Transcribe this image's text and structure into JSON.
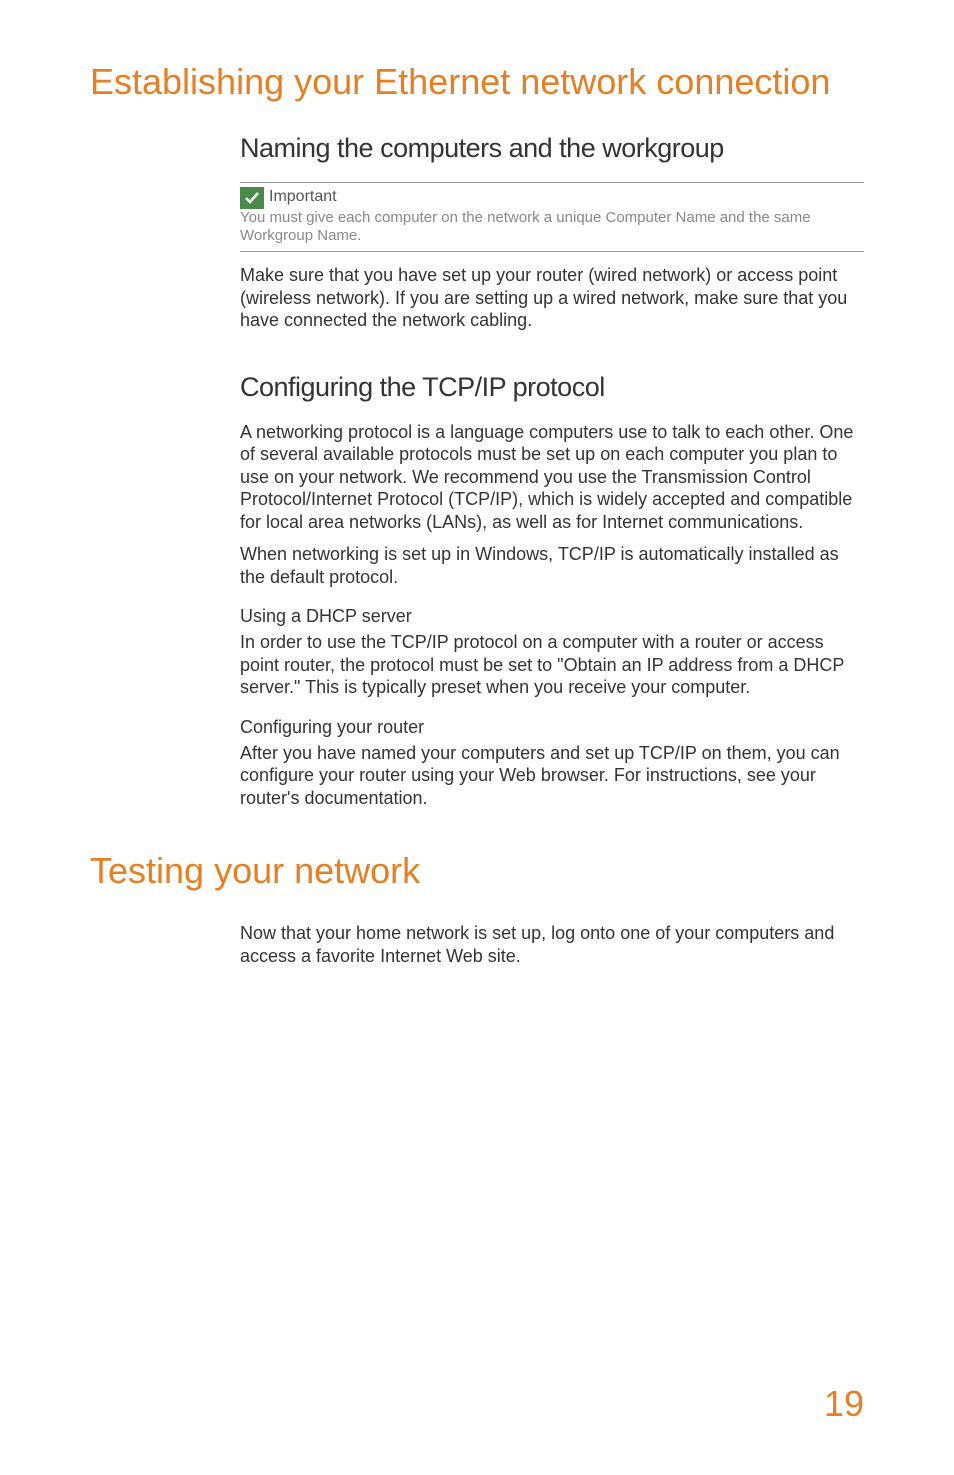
{
  "section1": {
    "title": "Establishing your Ethernet network connection",
    "sub1": {
      "title": "Naming the computers and the workgroup",
      "important_label": "Important",
      "important_text": "You must give each computer on the network a unique Computer Name and the same Workgroup Name.",
      "body": "Make sure that you have set up your router (wired network) or access point (wireless network). If you are setting up a wired network, make sure that you have connected the network cabling."
    },
    "sub2": {
      "title": "Configuring the TCP/IP protocol",
      "body1": "A networking protocol is a language computers use to talk to each other. One of several available protocols must be set up on each computer you plan to use on your network. We recommend you use the Transmission Control Protocol/Internet Protocol (TCP/IP), which is widely accepted and compatible for local area networks (LANs), as well as for Internet communications.",
      "body2": "When networking is set up in Windows, TCP/IP is automatically installed as the default protocol.",
      "dhcp_heading": "Using a DHCP server",
      "dhcp_body": "In order to use the TCP/IP protocol on a computer with a router or access point router, the protocol must be set to \"Obtain an IP address from a DHCP server.\" This is typically preset when you receive your computer.",
      "router_heading": "Configuring your router",
      "router_body": "After you have named your computers and set up TCP/IP on them, you can configure your router using your Web browser. For instructions, see your router's documentation."
    }
  },
  "section2": {
    "title": "Testing your network",
    "body": "Now that your home network is set up, log onto one of your computers and access a favorite Internet Web site."
  },
  "page_number": "19"
}
